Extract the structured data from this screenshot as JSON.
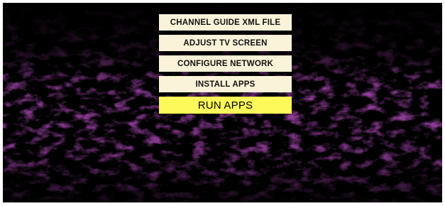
{
  "menu": {
    "items": [
      {
        "label": "CHANNEL GUIDE XML FILE"
      },
      {
        "label": "ADJUST TV SCREEN"
      },
      {
        "label": "CONFIGURE NETWORK"
      },
      {
        "label": "INSTALL APPS"
      },
      {
        "label": "RUN APPS",
        "selected": true
      }
    ]
  },
  "colors": {
    "background": "#000000",
    "texture": "#4a0f52",
    "button": "#fbf3d9",
    "selected_button": "#fdf85a"
  }
}
